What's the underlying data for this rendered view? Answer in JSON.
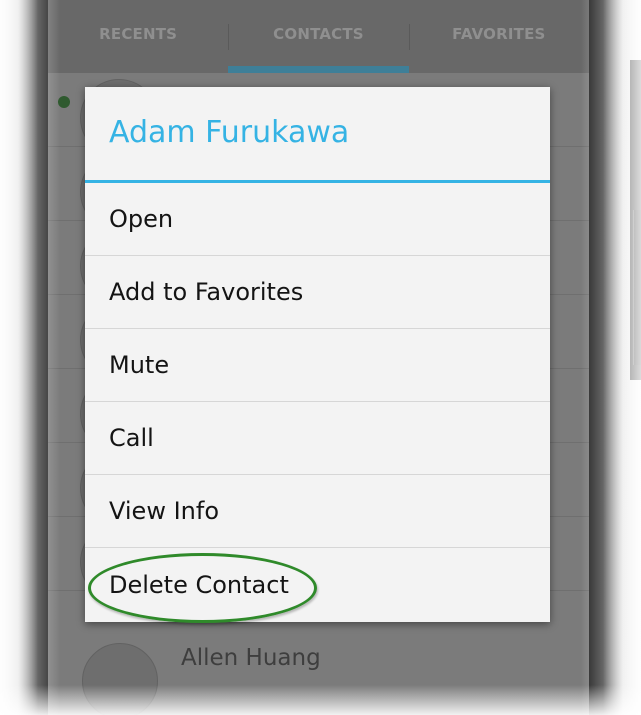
{
  "tabs": [
    "RECENTS",
    "CONTACTS",
    "FAVORITES"
  ],
  "active_tab": "CONTACTS",
  "background_contact": {
    "name": "Allen Huang"
  },
  "dialog": {
    "title": "Adam Furukawa",
    "items": [
      {
        "label": "Open"
      },
      {
        "label": "Add to Favorites"
      },
      {
        "label": "Mute"
      },
      {
        "label": "Call"
      },
      {
        "label": "View Info"
      },
      {
        "label": "Delete Contact"
      }
    ]
  },
  "colors": {
    "accent": "#35b3e4",
    "active_tab_indicator": "#3e7f98",
    "highlight_ring": "#2f8a2a",
    "presence_online": "#2f5a2f"
  }
}
